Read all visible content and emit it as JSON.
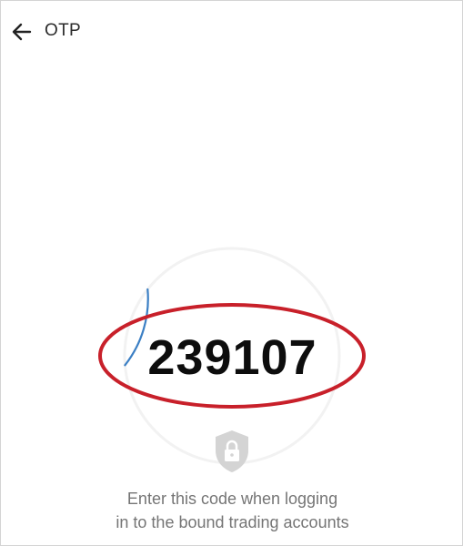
{
  "header": {
    "title": "OTP",
    "back_icon": "arrow-left-icon"
  },
  "otp": {
    "code": "239107",
    "countdown_remaining_fraction": 0.12
  },
  "shield_icon": "shield-lock-icon",
  "hint": {
    "line1": "Enter this code when logging",
    "line2": "in to the bound trading accounts"
  },
  "colors": {
    "highlight_ellipse": "#c8202a",
    "countdown_arc": "#3b7fc4",
    "track": "#f2f2f2",
    "shield": "#d4d4d4",
    "hint_text": "#757575"
  }
}
